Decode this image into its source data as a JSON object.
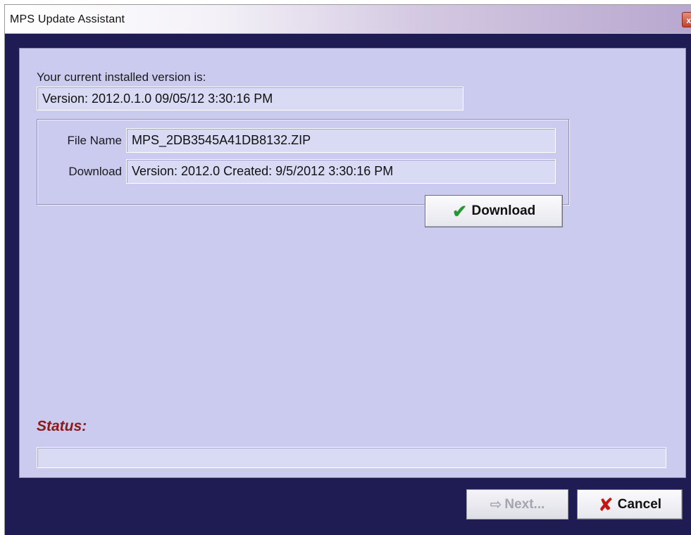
{
  "window": {
    "title": "MPS Update Assistant",
    "close_glyph": "x"
  },
  "installed": {
    "label": "Your current installed version is:",
    "value": "Version: 2012.0.1.0 09/05/12 3:30:16 PM"
  },
  "file": {
    "name_label": "File Name",
    "name_value": "MPS_2DB3545A41DB8132.ZIP",
    "download_label": "Download",
    "download_value": "Version: 2012.0 Created: 9/5/2012 3:30:16 PM"
  },
  "buttons": {
    "download_label": "Download",
    "download_icon": "checkmark-icon",
    "next_label": "Next...",
    "next_icon": "arrow-right-icon",
    "cancel_label": "Cancel",
    "cancel_icon": "x-icon"
  },
  "status": {
    "label": "Status:",
    "value": ""
  },
  "colors": {
    "window_frame": "#1e1c52",
    "panel": "#cacbef",
    "status_label": "#8b1a1a",
    "check": "#1f9a2a",
    "cancel_x": "#c51616"
  }
}
